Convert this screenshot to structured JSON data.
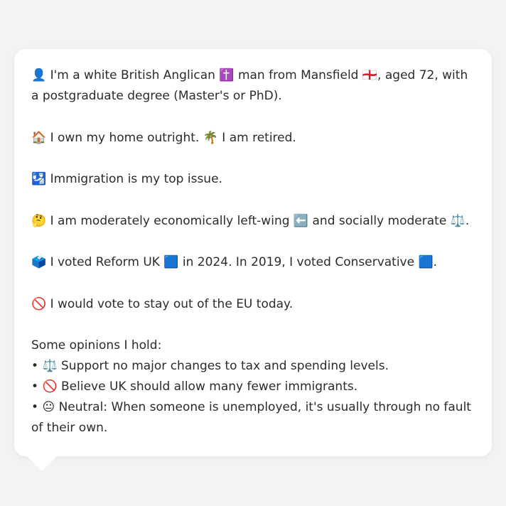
{
  "profile": {
    "intro_emoji": "👤",
    "intro_a": " I'm a white British Anglican ",
    "cross_emoji": "✝️",
    "intro_b": " man from Mansfield ",
    "flag_emoji": "🏴󠁧󠁢󠁥󠁮󠁧󠁿",
    "intro_c": ", aged 72, with a postgraduate degree (Master's or PhD).",
    "home_emoji": "🏠",
    "home_text": " I own my home outright. ",
    "palm_emoji": "🌴",
    "retired_text": " I am retired.",
    "immig_emoji": "🛂",
    "immig_text": " Immigration is my top issue.",
    "think_emoji": "🤔",
    "econ_a": " I am moderately economically left-wing ",
    "left_emoji": "⬅️",
    "econ_b": " and socially moderate ",
    "scale_emoji": "⚖️",
    "econ_c": ".",
    "ballot_emoji": "🗳️",
    "vote_a": " I voted Reform UK ",
    "blue1_emoji": "🟦",
    "vote_b": " in 2024. In 2019, I voted Conservative ",
    "blue2_emoji": "🟦",
    "vote_c": ".",
    "no_emoji": "🚫",
    "eu_text": " I would vote to stay out of the EU today.",
    "opinions_heading": "Some opinions I hold:",
    "op1_bullet": "• ",
    "op1_emoji": "⚖️",
    "op1_text": " Support no major changes to tax and spending levels.",
    "op2_bullet": "• ",
    "op2_emoji": "🚫",
    "op2_text": " Believe UK should allow many fewer immigrants.",
    "op3_bullet": "• ",
    "op3_emoji": "😐",
    "op3_text": " Neutral: When someone is unemployed, it's usually through no fault of their own."
  }
}
